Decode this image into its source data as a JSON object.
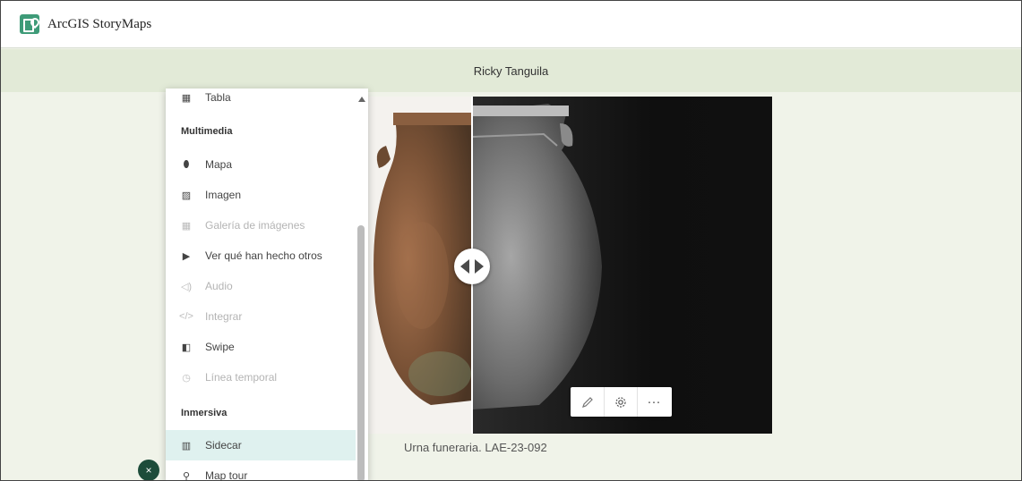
{
  "header": {
    "app_title": "ArcGIS StoryMaps",
    "logo_icon": "storymaps-logo-icon"
  },
  "story": {
    "author": "Ricky Tanguila"
  },
  "swipe_block": {
    "caption": "Urna funeraria. LAE-23-092"
  },
  "block_toolbar": {
    "edit_icon": "pencil-icon",
    "settings_icon": "gear-icon",
    "more_label": "···"
  },
  "block_menu": {
    "items": [
      {
        "label": "Tabla",
        "icon": "table-icon",
        "glyph": "▦",
        "disabled": false
      },
      {
        "label": "Mapa",
        "icon": "map-pin-icon",
        "glyph": "⬮",
        "disabled": false
      },
      {
        "label": "Imagen",
        "icon": "image-icon",
        "glyph": "▨",
        "disabled": false
      },
      {
        "label": "Galería de imágenes",
        "icon": "gallery-icon",
        "glyph": "▦",
        "disabled": true
      },
      {
        "label": "Ver qué han hecho otros",
        "icon": "video-icon",
        "glyph": "▶",
        "disabled": false
      },
      {
        "label": "Audio",
        "icon": "audio-icon",
        "glyph": "◁)",
        "disabled": true
      },
      {
        "label": "Integrar",
        "icon": "embed-icon",
        "glyph": "</>",
        "disabled": true
      },
      {
        "label": "Swipe",
        "icon": "swipe-icon",
        "glyph": "◧",
        "disabled": false
      },
      {
        "label": "Línea temporal",
        "icon": "timeline-icon",
        "glyph": "◷",
        "disabled": true
      },
      {
        "label": "Sidecar",
        "icon": "sidecar-icon",
        "glyph": "▥",
        "disabled": false,
        "selected": true
      },
      {
        "label": "Map tour",
        "icon": "map-tour-icon",
        "glyph": "⚲",
        "disabled": false
      }
    ],
    "sections": {
      "multimedia": "Multimedia",
      "immersive": "Inmersiva"
    }
  },
  "close_button": {
    "label": "×"
  }
}
